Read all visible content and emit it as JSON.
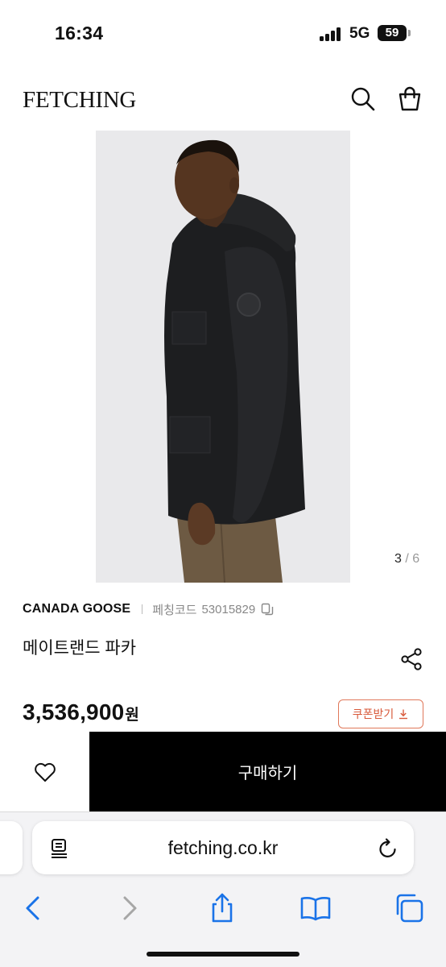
{
  "status_bar": {
    "time": "16:34",
    "network": "5G",
    "battery": "59"
  },
  "header": {
    "logo": "FETCHING",
    "icons": [
      "search-icon",
      "shopping-bag-icon"
    ]
  },
  "gallery": {
    "current": "3",
    "separator": "/",
    "total": "6"
  },
  "product": {
    "brand": "CANADA GOOSE",
    "code_label": "페칭코드",
    "code_value": "53015829",
    "name": "메이트랜드 파카",
    "price": "3,536,900",
    "currency": "원",
    "coupon_label": "쿠폰받기"
  },
  "actions": {
    "buy_label": "구매하기"
  },
  "browser": {
    "url": "fetching.co.kr"
  },
  "colors": {
    "accent_coupon": "#e0785a",
    "buy_button": "#000000",
    "image_background": "#e9e9eb"
  }
}
